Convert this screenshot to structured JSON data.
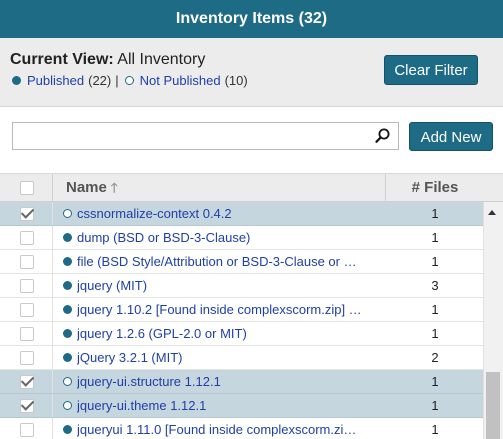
{
  "header": {
    "title": "Inventory Items (32)"
  },
  "filter": {
    "current_view_label": "Current View:",
    "current_view_value": "All Inventory",
    "published_label": "Published",
    "published_count": "(22)",
    "separator": "|",
    "not_published_label": "Not Published",
    "not_published_count": "(10)",
    "clear_filter_label": "Clear Filter"
  },
  "search": {
    "value": "",
    "placeholder": "",
    "add_new_label": "Add New"
  },
  "table": {
    "columns": {
      "name": "Name",
      "files": "# Files"
    },
    "rows": [
      {
        "name": "cssnormalize-context 0.4.2",
        "files": "1",
        "published": false,
        "selected": true
      },
      {
        "name": "dump (BSD or BSD-3-Clause)",
        "files": "1",
        "published": true,
        "selected": false
      },
      {
        "name": "file (BSD Style/Attribution or BSD-3-Clause or …",
        "files": "1",
        "published": true,
        "selected": false
      },
      {
        "name": "jquery (MIT)",
        "files": "3",
        "published": true,
        "selected": false
      },
      {
        "name": "jquery 1.10.2 [Found inside complexscorm.zip] …",
        "files": "1",
        "published": true,
        "selected": false
      },
      {
        "name": "jquery 1.2.6 (GPL-2.0 or MIT)",
        "files": "1",
        "published": true,
        "selected": false
      },
      {
        "name": "jQuery 3.2.1 (MIT)",
        "files": "2",
        "published": true,
        "selected": false
      },
      {
        "name": "jquery-ui.structure 1.12.1",
        "files": "1",
        "published": false,
        "selected": true
      },
      {
        "name": "jquery-ui.theme 1.12.1",
        "files": "1",
        "published": false,
        "selected": true
      },
      {
        "name": "jqueryui 1.11.0 [Found inside complexscorm.zi…",
        "files": "1",
        "published": true,
        "selected": false
      }
    ]
  },
  "colors": {
    "accent": "#1e6b86",
    "selected_row": "#c5d6df",
    "link": "#1f3fa8"
  },
  "icons": {
    "search": "magnifier-icon",
    "sort": "sort-up-arrow-icon",
    "scroll_up": "scroll-up-arrow-icon"
  }
}
